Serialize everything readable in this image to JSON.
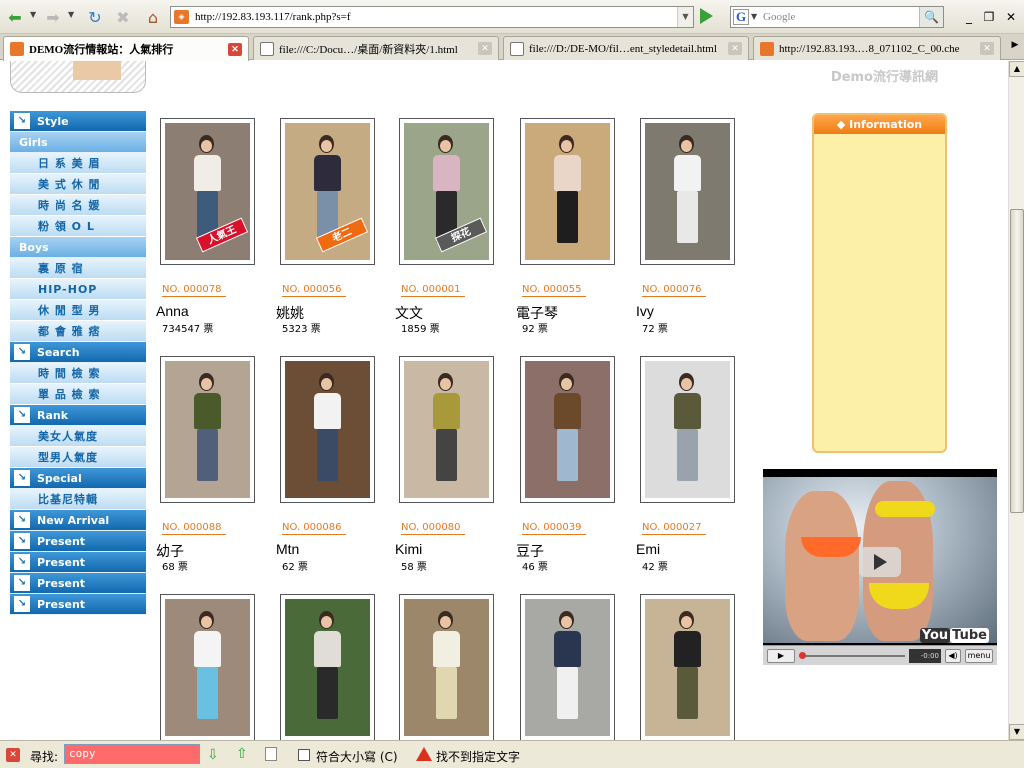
{
  "browser": {
    "url": "http://192.83.193.117/rank.php?s=f",
    "search_placeholder": "Google",
    "search_engine_letter": "G"
  },
  "tabs": [
    {
      "label": "DEMO流行情報站：人氣排行",
      "active": true,
      "icon": "site"
    },
    {
      "label": "file:///C:/Docu…/桌面/新資料夾/1.html",
      "active": false,
      "icon": "file"
    },
    {
      "label": "file:///D:/DE-MO/fil…ent_styledetail.html",
      "active": false,
      "icon": "file"
    },
    {
      "label": "http://192.83.193.…8_071102_C_00.che",
      "active": false,
      "icon": "site"
    }
  ],
  "site_brand": "Demo流行導訊網",
  "sidebar": [
    {
      "type": "head",
      "label": "Style"
    },
    {
      "type": "section",
      "label": "Girls"
    },
    {
      "type": "sub",
      "label": "日 系 美 眉"
    },
    {
      "type": "sub",
      "label": "美 式 休 閒"
    },
    {
      "type": "sub",
      "label": "時 尚 名 媛"
    },
    {
      "type": "sub",
      "label": "粉 領 O L"
    },
    {
      "type": "section",
      "label": "Boys"
    },
    {
      "type": "sub",
      "label": "裏 原 宿"
    },
    {
      "type": "sub",
      "label": "HIP-HOP"
    },
    {
      "type": "sub",
      "label": "休 閒 型 男"
    },
    {
      "type": "sub",
      "label": "都 會 雅 痞"
    },
    {
      "type": "head",
      "label": "Search"
    },
    {
      "type": "sub",
      "label": "時 間 檢 索"
    },
    {
      "type": "sub",
      "label": "單 品 檢 索"
    },
    {
      "type": "head",
      "label": "Rank"
    },
    {
      "type": "sub",
      "label": "美女人氣度"
    },
    {
      "type": "sub",
      "label": "型男人氣度"
    },
    {
      "type": "head",
      "label": "Special"
    },
    {
      "type": "sub",
      "label": "比基尼特輯"
    },
    {
      "type": "head",
      "label": "New Arrival"
    },
    {
      "type": "head",
      "label": "Present"
    },
    {
      "type": "head",
      "label": "Present"
    },
    {
      "type": "head",
      "label": "Present"
    },
    {
      "type": "head",
      "label": "Present"
    }
  ],
  "cards": [
    {
      "no": "NO. 000078",
      "name": "Anna",
      "votes": "734547 票",
      "tag": "人氣王",
      "tag_color": "#d8102a",
      "top": "#f2ece6",
      "bottom": "#3d5b7a",
      "bg": "#8c7e72"
    },
    {
      "no": "NO. 000056",
      "name": "姚姚",
      "votes": "5323 票",
      "tag": "老二",
      "tag_color": "#f06a10",
      "top": "#2e2b3d",
      "bottom": "#7a8fa8",
      "bg": "#c5ab84"
    },
    {
      "no": "NO. 000001",
      "name": "文文",
      "votes": "1859 票",
      "tag": "探花",
      "tag_color": "#5a5a5a",
      "top": "#d9b4c2",
      "bottom": "#2a2a2a",
      "bg": "#9aa58a"
    },
    {
      "no": "NO. 000055",
      "name": "電子琴",
      "votes": "92 票",
      "tag": "",
      "tag_color": "",
      "top": "#e9d6c9",
      "bottom": "#1e1e1e",
      "bg": "#caa97b"
    },
    {
      "no": "NO. 000076",
      "name": "Ivy",
      "votes": "72 票",
      "tag": "",
      "tag_color": "",
      "top": "#f2f2f2",
      "bottom": "#e8e8e8",
      "bg": "#7f7a70"
    },
    {
      "no": "NO. 000088",
      "name": "幼子",
      "votes": "68 票",
      "tag": "",
      "tag_color": "",
      "top": "#4a5a2a",
      "bottom": "#51607a",
      "bg": "#b4a494"
    },
    {
      "no": "NO. 000086",
      "name": "Mtn",
      "votes": "62 票",
      "tag": "",
      "tag_color": "",
      "top": "#f2f2f2",
      "bottom": "#3b4b66",
      "bg": "#6b4e35"
    },
    {
      "no": "NO. 000080",
      "name": "Kimi",
      "votes": "58 票",
      "tag": "",
      "tag_color": "",
      "top": "#a89a3a",
      "bottom": "#444444",
      "bg": "#c9b9a4"
    },
    {
      "no": "NO. 000039",
      "name": "豆子",
      "votes": "46 票",
      "tag": "",
      "tag_color": "",
      "top": "#6a4a2a",
      "bottom": "#9fb8cf",
      "bg": "#8c6f68"
    },
    {
      "no": "NO. 000027",
      "name": "Emi",
      "votes": "42 票",
      "tag": "",
      "tag_color": "",
      "top": "#5a5a3a",
      "bottom": "#9aa3ad",
      "bg": "#dcdcdc"
    },
    {
      "no": "",
      "name": "",
      "votes": "",
      "tag": "",
      "tag_color": "",
      "top": "#f4f4f4",
      "bottom": "#6ac0e0",
      "bg": "#9d8a7a"
    },
    {
      "no": "",
      "name": "",
      "votes": "",
      "tag": "",
      "tag_color": "",
      "top": "#e0ddd6",
      "bottom": "#2a2a2a",
      "bg": "#4a6a3a"
    },
    {
      "no": "",
      "name": "",
      "votes": "",
      "tag": "",
      "tag_color": "",
      "top": "#f1eee2",
      "bottom": "#e0d7b0",
      "bg": "#9c876a"
    },
    {
      "no": "",
      "name": "",
      "votes": "",
      "tag": "",
      "tag_color": "",
      "top": "#2a3550",
      "bottom": "#f0f0f0",
      "bg": "#a8a8a4"
    },
    {
      "no": "",
      "name": "",
      "votes": "",
      "tag": "",
      "tag_color": "",
      "top": "#222222",
      "bottom": "#5a5a3a",
      "bg": "#c7b395"
    }
  ],
  "info_panel": {
    "title": "◆ Information"
  },
  "video": {
    "brand_you": "You",
    "brand_tube": "Tube",
    "time": "-0:00",
    "menu_label": "menu"
  },
  "findbar": {
    "label": "尋找:",
    "query": "copy",
    "match_case_label": "符合大小寫 (C)",
    "status": "找不到指定文字"
  }
}
